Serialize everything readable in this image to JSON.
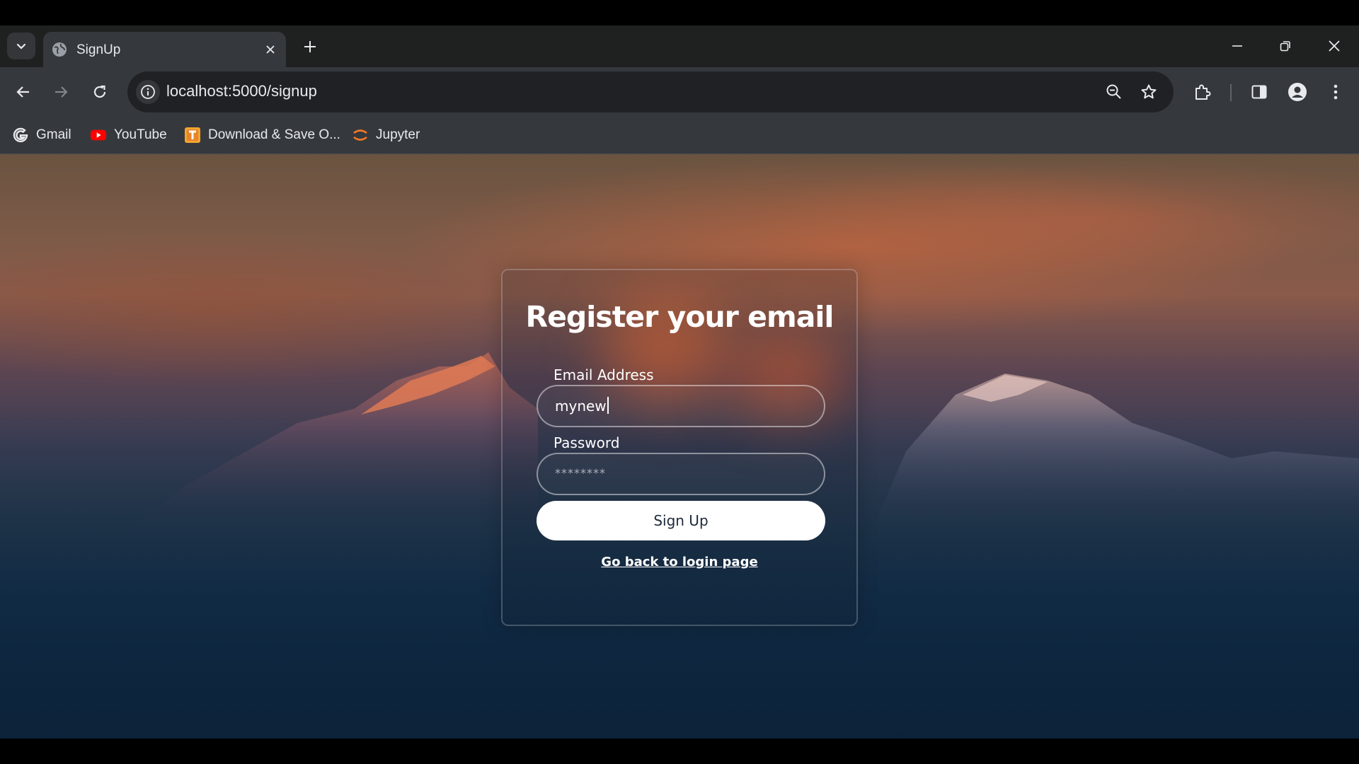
{
  "browser": {
    "tab": {
      "title": "SignUp"
    },
    "address_bar": {
      "url": "localhost:5000/signup"
    },
    "bookmarks": [
      {
        "label": "Gmail",
        "icon": "google-icon"
      },
      {
        "label": "YouTube",
        "icon": "youtube-icon"
      },
      {
        "label": "Download & Save O...",
        "icon": "download-site-icon"
      },
      {
        "label": "Jupyter",
        "icon": "jupyter-icon"
      }
    ]
  },
  "form": {
    "title": "Register your email",
    "email": {
      "label": "Email Address",
      "value": "mynew"
    },
    "password": {
      "label": "Password",
      "placeholder": "********"
    },
    "submit_label": "Sign Up",
    "back_link": "Go back to login page"
  },
  "colors": {
    "tabstrip": "#1f2020",
    "toolbar": "#35393e",
    "omnibox": "#202124",
    "button": "#ffffff"
  }
}
